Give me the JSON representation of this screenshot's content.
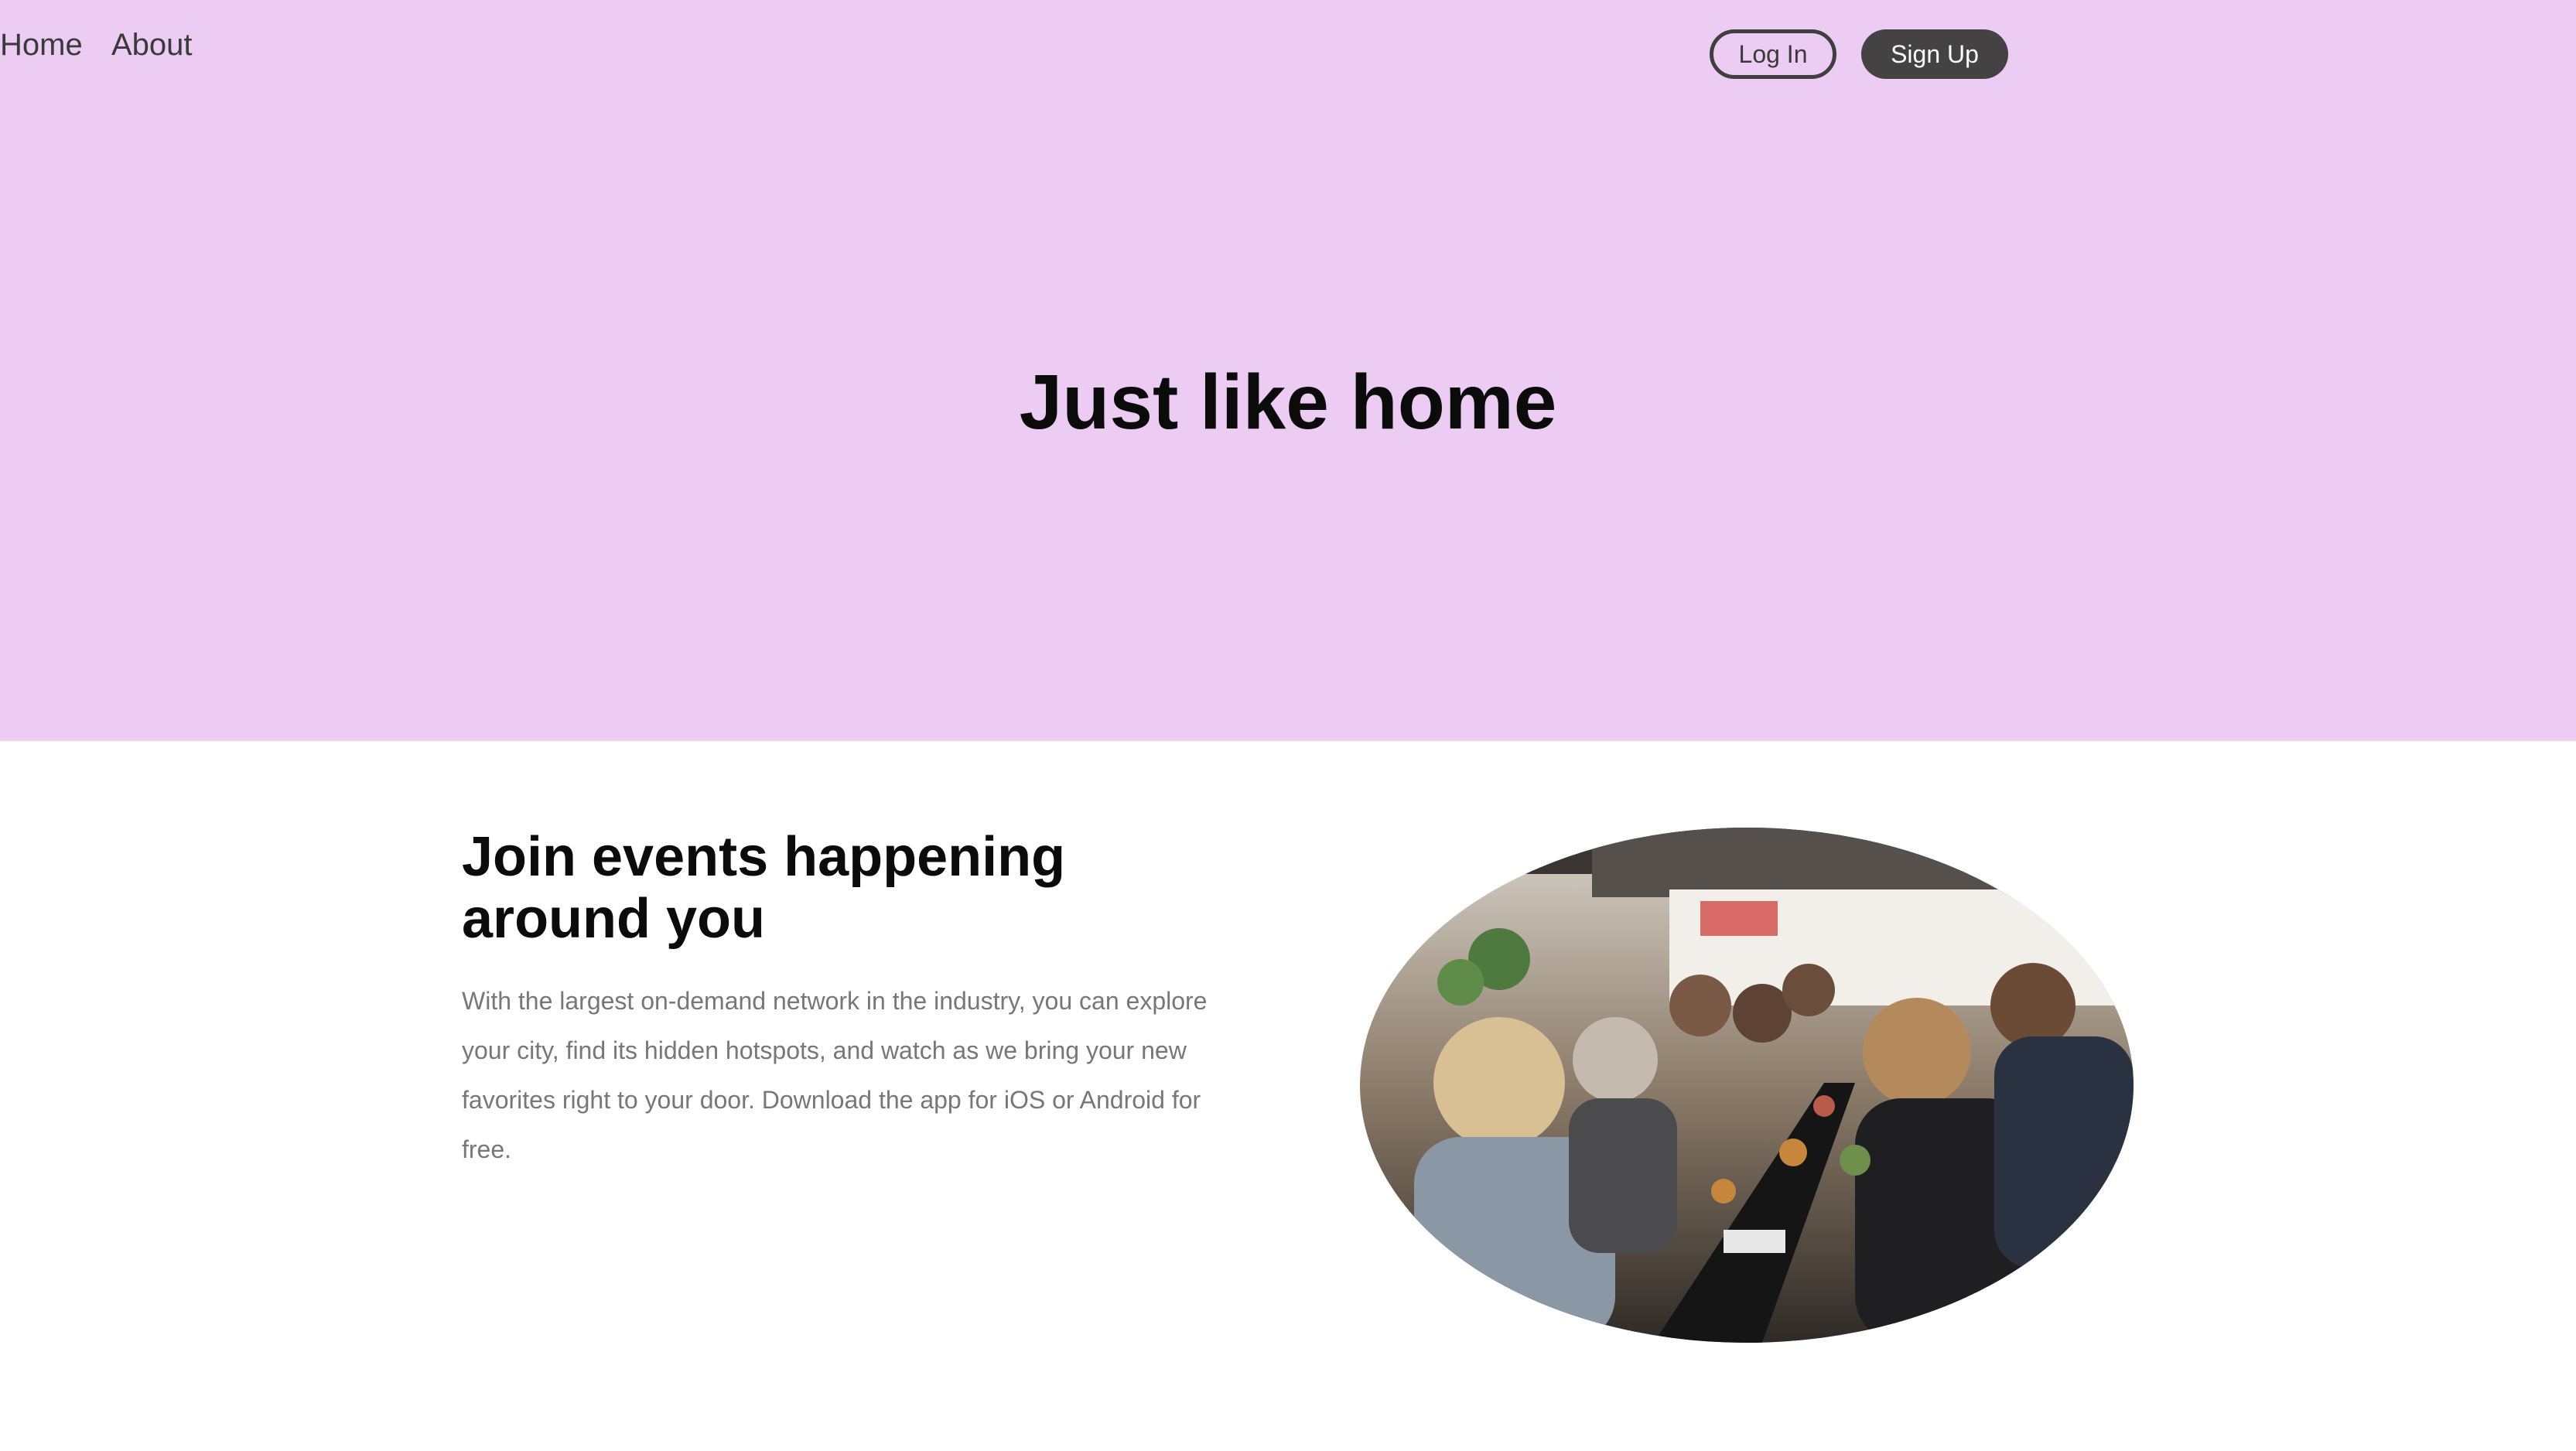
{
  "nav": {
    "home": "Home",
    "about": "About",
    "login": "Log In",
    "signup": "Sign Up"
  },
  "hero": {
    "title": "Just like home",
    "background_color": "#ecccf2"
  },
  "feature": {
    "title": "Join events happening around you",
    "body": "With the largest on-demand network in the industry, you can explore your city, find its hidden hotspots, and watch as we bring your new favorites right to your door. Download the app for iOS or Android for free.",
    "image_alt": "people dining together at a long table on a restaurant patio"
  },
  "colors": {
    "signup_bg": "#444242",
    "text_dark": "#0b0b0b",
    "text_muted": "#777777"
  }
}
